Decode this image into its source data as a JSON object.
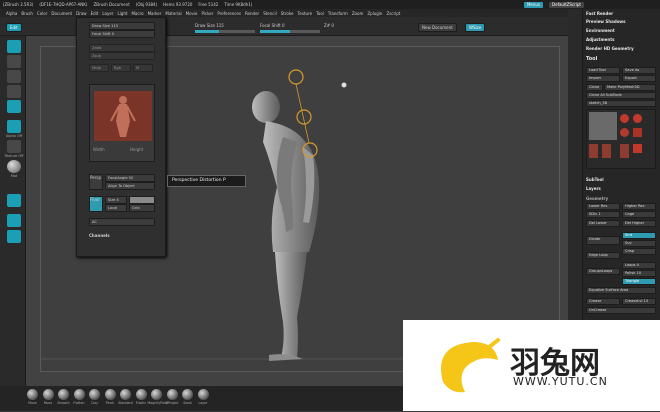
{
  "titlebar": {
    "app_title": "ZBrush 3.5R3",
    "items": [
      "(ZBrush 3.5R3)",
      "(DF1E-7HQD-AP67-ANK)",
      "ZBrush Document",
      "(Obj 9384)",
      "Hems 93.9720",
      "Free 5142",
      "Time 9K8dh1)"
    ],
    "menus_btn": "Menus",
    "script_btn": "DefaultZScript"
  },
  "menubar": [
    "Alpha",
    "Brush",
    "Color",
    "Document",
    "Draw",
    "Edit",
    "Layer",
    "Light",
    "Macro",
    "Marker",
    "Material",
    "Movie",
    "Picker",
    "Preferences",
    "Render",
    "Stencil",
    "Stroke",
    "Texture",
    "Tool",
    "Transform",
    "Zoom",
    "Zplugin",
    "Zscript"
  ],
  "topbar": {
    "draw_size": "Draw Size 115",
    "focal_shift": "Focal Shift 0",
    "rgb_label": "RGB",
    "value_z": "Z# 0",
    "new_document": "New Document",
    "wsize": "WSize"
  },
  "popup": {
    "draw_size": "Draw Size 115",
    "focal_shift": "Focal Shift 0",
    "rows": [
      "Zadd",
      "Zsub",
      "Mrgb",
      "Rgb",
      "M"
    ],
    "width_label": "Width",
    "height_label": "Height",
    "focal_angle": "FocalAngle 50",
    "align_to_object": "Align To Object",
    "persp": "Persp",
    "floor": "Floor",
    "local": "Local",
    "grid": "Grid",
    "channels": "Channels",
    "ac_label": "AC",
    "size_label": "Size 4"
  },
  "tooltip": "Perspective Distortion  P",
  "lefttray": {
    "labels": [
      "Alpha Off",
      "Texture Off",
      "Mat"
    ]
  },
  "rightpanel": {
    "heads": [
      "Fast Render",
      "Preview Shadows",
      "Environment",
      "Adjustments",
      "Render HD Geometry",
      "Tool"
    ],
    "load_tool": "Load Tool",
    "save_as": "Save As",
    "import": "Import",
    "export": "Export",
    "clone": "Clone",
    "make_polymesh": "Make PolyMesh3D",
    "clone_all": "Clone All SubTools",
    "sketch": "sketch_58",
    "subtool": "SubTool",
    "layers": "Layers",
    "geometry": "Geometry",
    "lower_res": "Lower Res",
    "higher_res": "Higher Res",
    "sdiv": "SDiv 1",
    "cage": "Cage",
    "del_lower": "Del Lower",
    "del_higher": "Del Higher",
    "divide": "Divide",
    "smt": "Smt",
    "suv": "Suv",
    "crisp": "Crisp",
    "edge_loop": "Edge Loop",
    "group_loops": "GroupsLoops",
    "loops": "Loops 4",
    "polish": "Polish 10",
    "triangle": "Triangle",
    "equalize": "Equalize Surface Area",
    "crease": "Crease",
    "crease_lvl": "CreaseLvl 15",
    "uncrease": "UnCrease"
  },
  "bottombar": {
    "brushes": [
      "Move",
      "Move",
      "Smooth",
      "Flatten",
      "Clay",
      "Pinch",
      "Standard",
      "Elastic",
      "MagnifyPoint",
      "ZProject",
      "Slash",
      "Layer"
    ]
  },
  "watermark": {
    "brand": "羽兔网",
    "url": "WWW.YUTU.CN"
  },
  "colors": {
    "accent": "#2e9bb0",
    "bg": "#3a3a3a",
    "logo_yellow": "#f5c518"
  }
}
